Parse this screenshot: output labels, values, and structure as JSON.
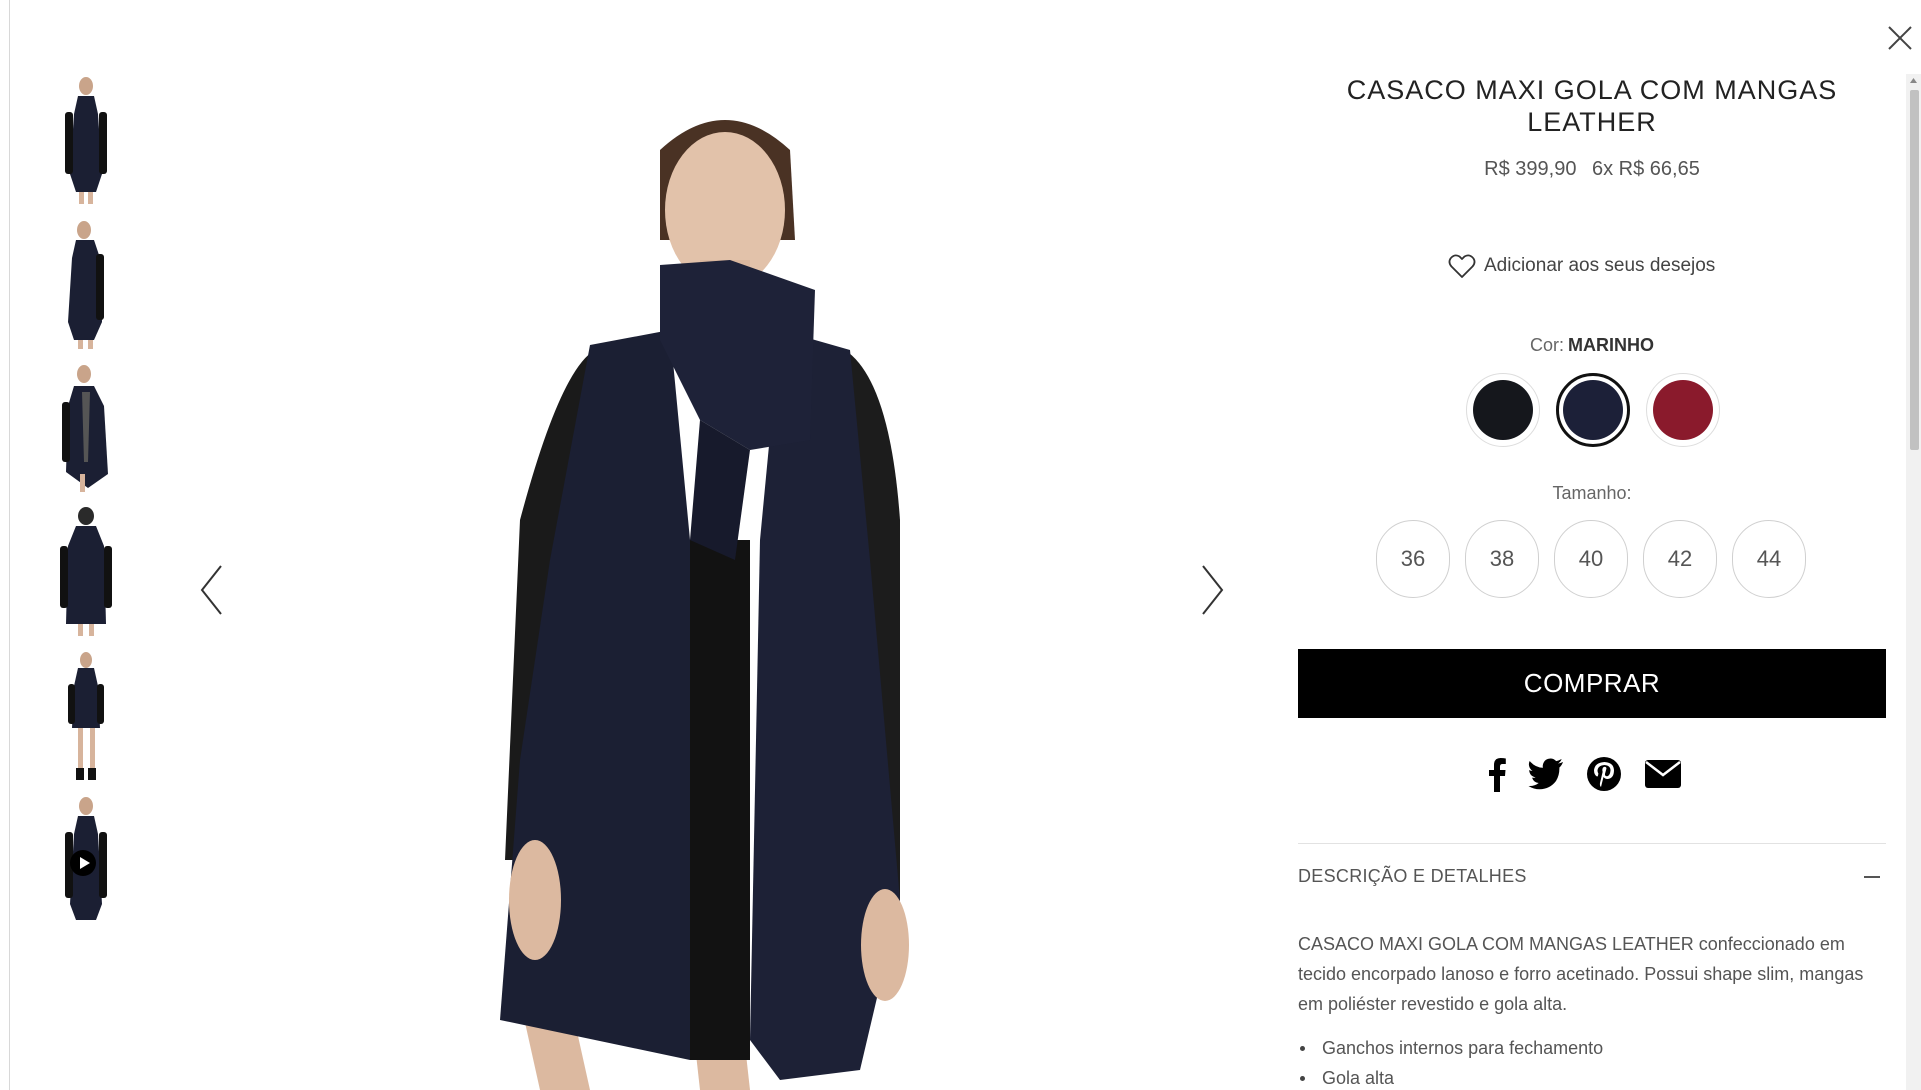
{
  "product": {
    "title": "CASACO MAXI GOLA COM MANGAS LEATHER",
    "price": "R$ 399,90",
    "installments": "6x R$ 66,65",
    "wishlist_label": "Adicionar aos seus desejos",
    "color_label": "Cor:",
    "color_selected": "MARINHO",
    "colors": [
      {
        "name": "preto",
        "hex": "#15171c"
      },
      {
        "name": "marinho",
        "hex": "#1c2038"
      },
      {
        "name": "bordo",
        "hex": "#8a1a2c"
      }
    ],
    "size_label": "Tamanho:",
    "sizes": [
      "36",
      "38",
      "40",
      "42",
      "44"
    ],
    "buy_label": "COMPRAR",
    "share_icons": [
      "facebook-icon",
      "twitter-icon",
      "pinterest-icon",
      "email-icon"
    ],
    "details_title": "DESCRIÇÃO E DETALHES",
    "description": "CASACO MAXI GOLA COM MANGAS LEATHER confeccionado em tecido encorpado lanoso e forro acetinado. Possui shape slim, mangas em poliéster revestido e gola alta.",
    "details": [
      "Ganchos internos para fechamento",
      "Gola alta"
    ]
  },
  "gallery": {
    "thumbnail_count": 6,
    "video_thumbnail_index": 5
  },
  "colors": {
    "coat": "#1b1f33",
    "sleeve": "#1a1a1a",
    "buy_bg": "#000000",
    "text": "#333333"
  }
}
